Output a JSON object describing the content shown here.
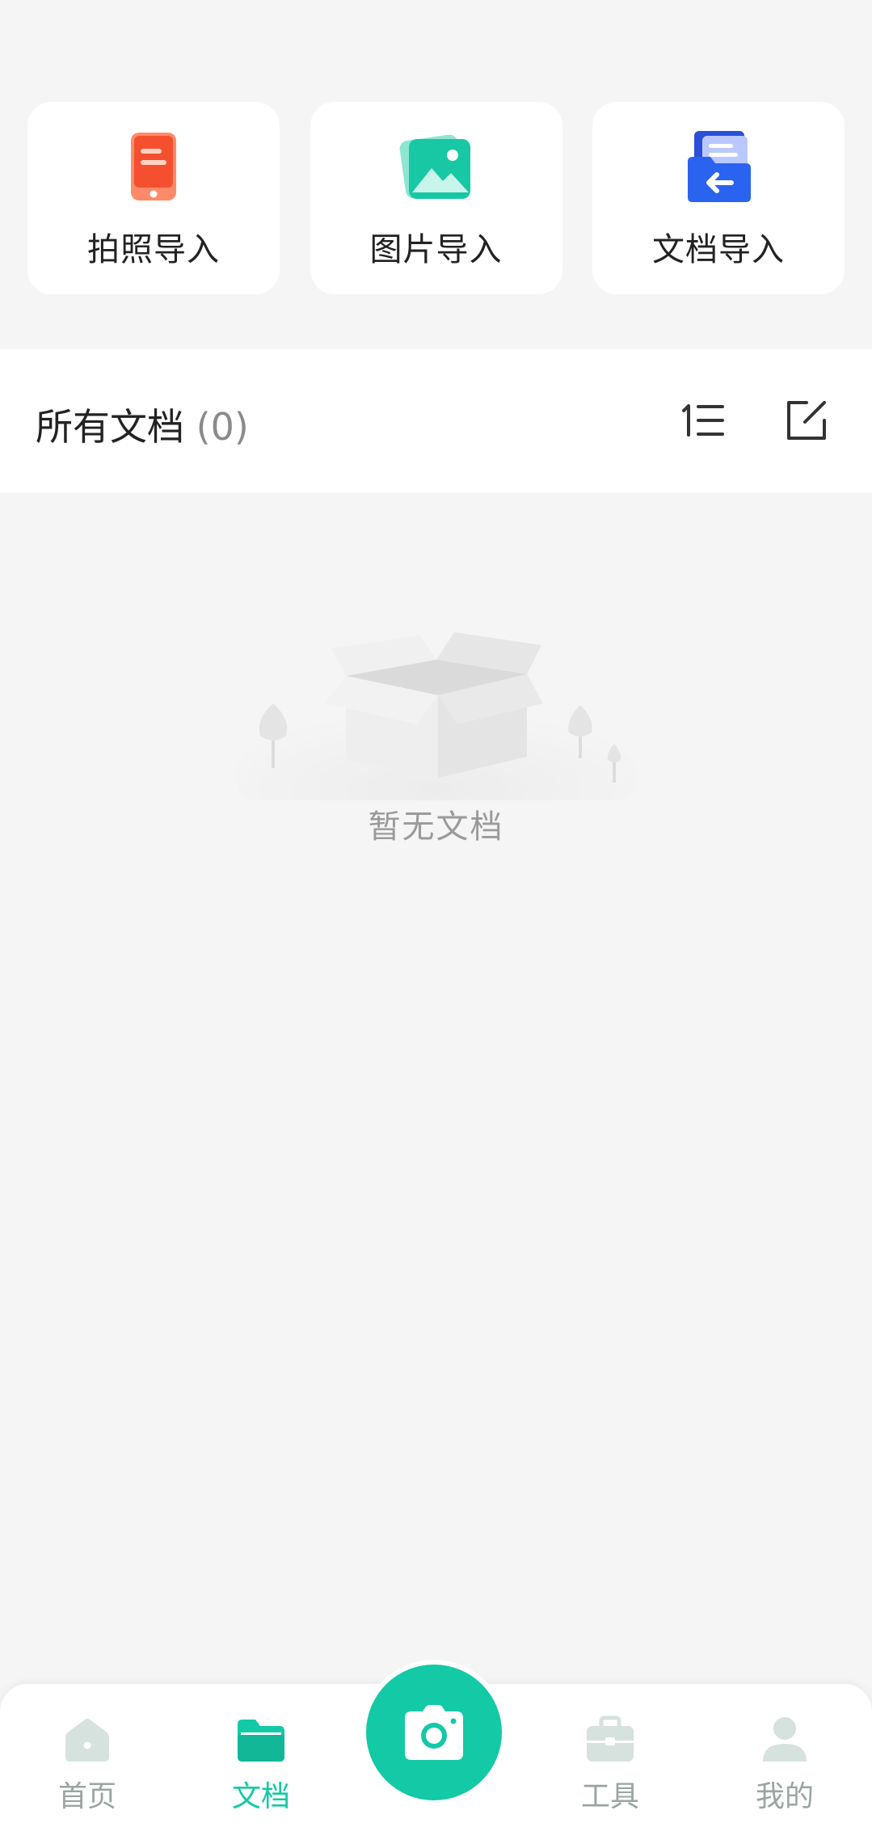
{
  "import_cards": [
    {
      "label": "拍照导入",
      "icon": "phone-camera-icon"
    },
    {
      "label": "图片导入",
      "icon": "image-icon"
    },
    {
      "label": "文档导入",
      "icon": "document-import-icon"
    }
  ],
  "docs": {
    "title": "所有文档",
    "count": "(0)",
    "sort_icon": "sort-list-icon",
    "edit_icon": "edit-icon"
  },
  "empty_state": {
    "text": "暂无文档",
    "illustration": "empty-box-illustration"
  },
  "bottom_nav": {
    "items": [
      {
        "label": "首页",
        "icon": "home-icon",
        "active": false
      },
      {
        "label": "文档",
        "icon": "folder-icon",
        "active": true
      },
      {
        "label": "工具",
        "icon": "toolbox-icon",
        "active": false
      },
      {
        "label": "我的",
        "icon": "user-icon",
        "active": false
      }
    ],
    "center_button_icon": "camera-icon"
  },
  "colors": {
    "accent": "#13c9a6",
    "photo_import": "#f4502f",
    "image_import": "#18c7a4",
    "doc_import": "#2a63f0",
    "inactive_nav": "#9aa5a2"
  }
}
